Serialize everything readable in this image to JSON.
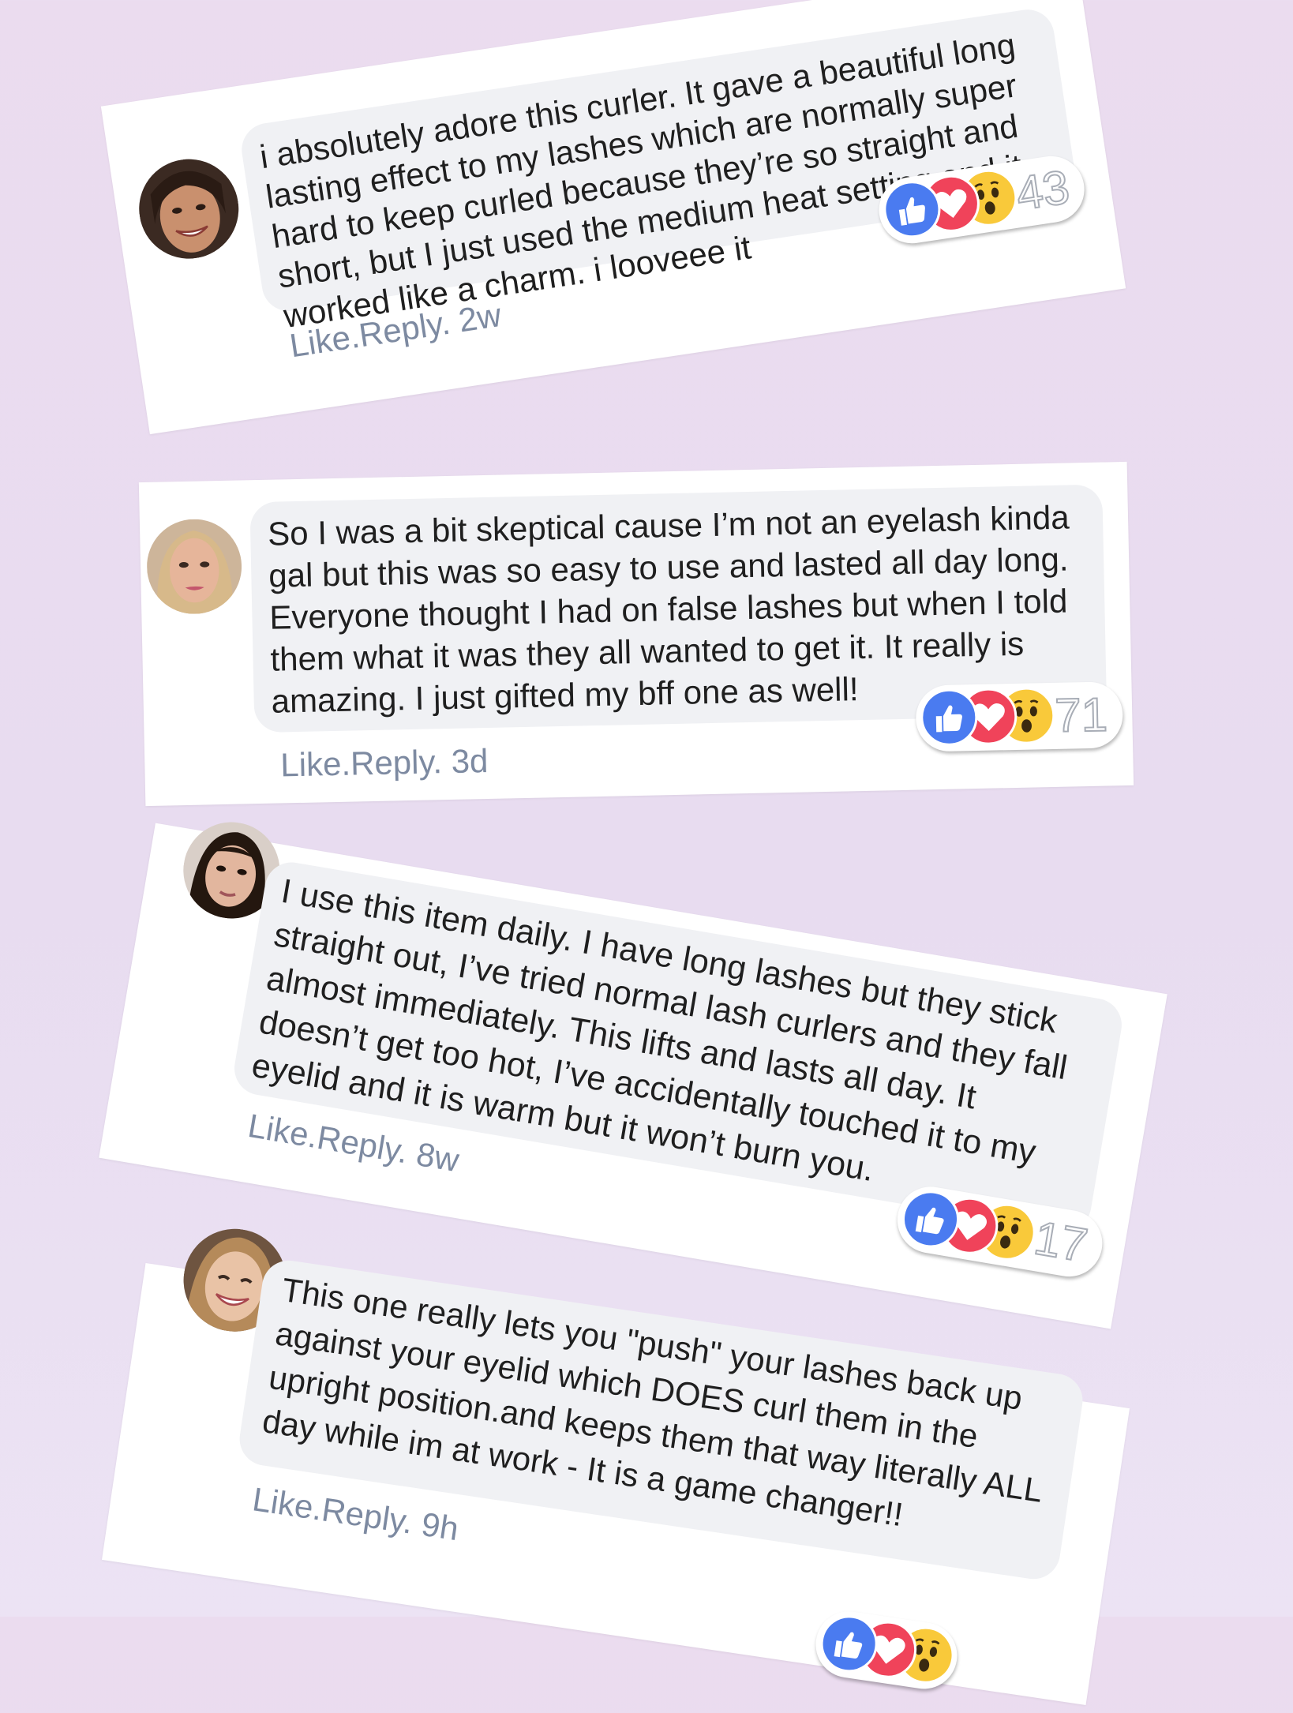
{
  "colors": {
    "background": "#ebdcef",
    "card": "#ffffff",
    "bubble": "#f0f1f4",
    "action_text": "#7d8aa1",
    "like": "#4a7bf0",
    "love": "#f0435a",
    "wow": "#f9c93a"
  },
  "comments": [
    {
      "text": "i absolutely adore this curler. It gave a beautiful long lasting effect to my lashes which are normally super hard to keep curled because they’re so straight and short, but I just used the medium heat setting and it worked like a charm. i looveee it",
      "actions": "Like.Reply. 2w",
      "reactions": [
        "like-icon",
        "love-icon",
        "wow-icon"
      ],
      "reaction_count": "43"
    },
    {
      "text": "So I was a bit skeptical cause I’m not an eyelash kinda gal but this was so easy to use and lasted all day long. Everyone thought I had on false lashes but when I told them what it was they all wanted to get it. It really is amazing. I just gifted my bff one as well!",
      "actions": "Like.Reply. 3d",
      "reactions": [
        "like-icon",
        "love-icon",
        "wow-icon"
      ],
      "reaction_count": "71"
    },
    {
      "text": "I use this item daily. I have long lashes but they stick straight out, I’ve tried normal lash curlers and they fall almost immediately. This lifts and lasts all day. It doesn’t get too hot, I’ve accidentally touched it to my eyelid and it is warm but it won’t burn you.",
      "actions": "Like.Reply. 8w",
      "reactions": [
        "like-icon",
        "love-icon",
        "wow-icon"
      ],
      "reaction_count": "17"
    },
    {
      "text": "This one really lets you \"push\" your lashes back up against your eyelid which DOES curl them in the upright position.and keeps them that way literally ALL day while im at work - It is a game changer!!",
      "actions": "Like.Reply. 9h",
      "reactions": [
        "like-icon",
        "love-icon",
        "wow-icon"
      ],
      "reaction_count": ""
    }
  ]
}
